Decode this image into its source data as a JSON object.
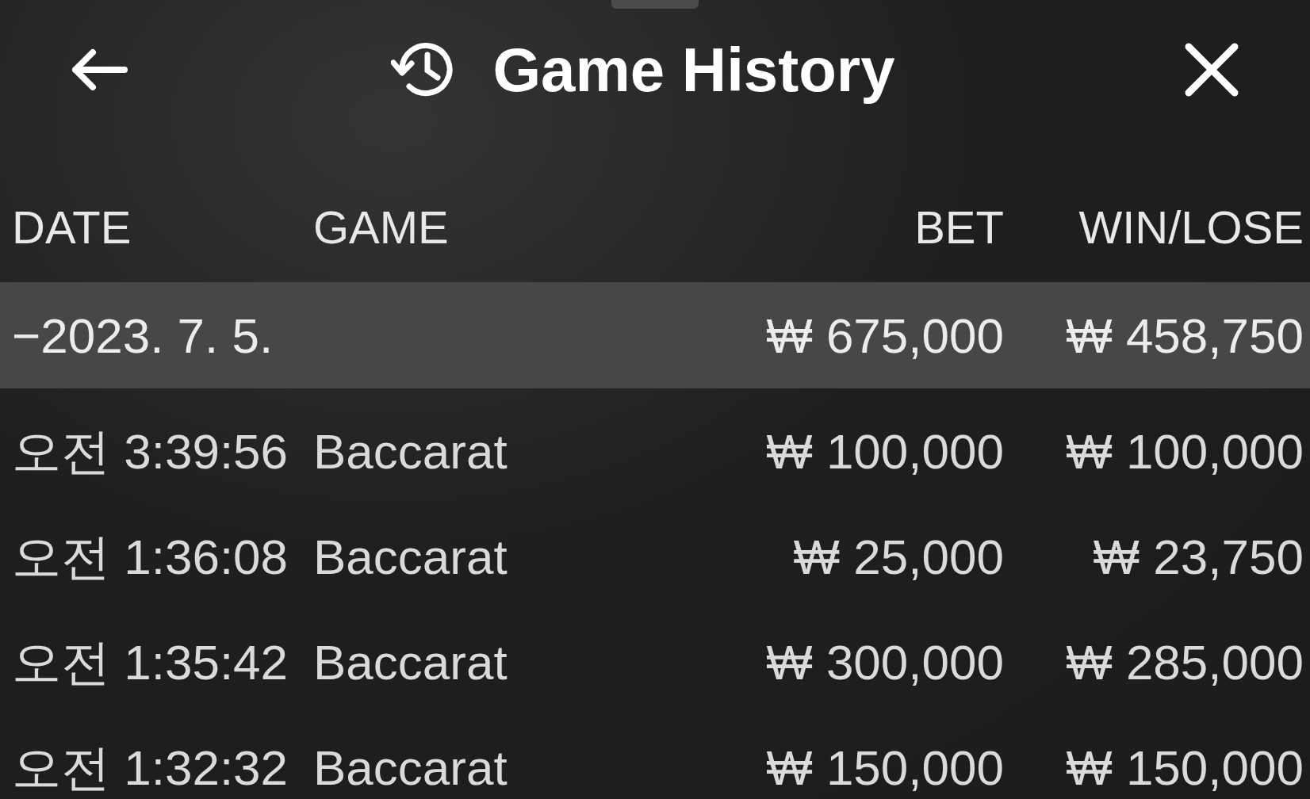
{
  "header": {
    "title": "Game History"
  },
  "columns": [
    "DATE",
    "GAME",
    "BET",
    "WIN/LOSE"
  ],
  "date_group": {
    "date": "−2023. 7. 5.",
    "bet": "₩ 675,000",
    "win_lose": "₩ 458,750"
  },
  "rows": [
    {
      "time": "오전 3:39:56",
      "game": "Baccarat",
      "bet": "₩ 100,000",
      "win_lose": "₩ 100,000"
    },
    {
      "time": "오전 1:36:08",
      "game": "Baccarat",
      "bet": "₩ 25,000",
      "win_lose": "₩ 23,750"
    },
    {
      "time": "오전 1:35:42",
      "game": "Baccarat",
      "bet": "₩ 300,000",
      "win_lose": "₩ 285,000"
    },
    {
      "time": "오전 1:32:32",
      "game": "Baccarat",
      "bet": "₩ 150,000",
      "win_lose": "₩ 150,000"
    }
  ]
}
